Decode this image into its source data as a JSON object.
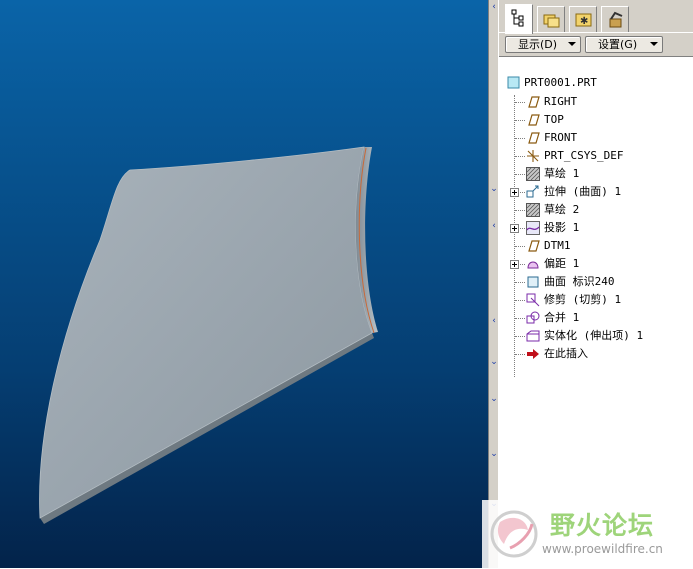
{
  "tabs": [
    {
      "name": "model-tree-tab",
      "icon": "model-tree-icon",
      "active": true
    },
    {
      "name": "folder-browser-tab",
      "icon": "folder-browser-icon",
      "active": false
    },
    {
      "name": "favorites-tab",
      "icon": "favorites-icon",
      "active": false
    },
    {
      "name": "connections-tab",
      "icon": "connections-icon",
      "active": false
    }
  ],
  "toolbar": {
    "show_label": "显示(D)",
    "settings_label": "设置(G)"
  },
  "tree": {
    "root": "PRT0001.PRT",
    "items": [
      {
        "label": "RIGHT",
        "icon": "datum-plane-icon",
        "expandable": false
      },
      {
        "label": "TOP",
        "icon": "datum-plane-icon",
        "expandable": false
      },
      {
        "label": "FRONT",
        "icon": "datum-plane-icon",
        "expandable": false
      },
      {
        "label": "PRT_CSYS_DEF",
        "icon": "coordinate-system-icon",
        "expandable": false
      },
      {
        "label": "草绘 1",
        "icon": "sketch-icon",
        "expandable": false
      },
      {
        "label": "拉伸 (曲面) 1",
        "icon": "extrude-surface-icon",
        "expandable": true
      },
      {
        "label": "草绘 2",
        "icon": "sketch-icon",
        "expandable": false
      },
      {
        "label": "投影 1",
        "icon": "projection-icon",
        "expandable": true
      },
      {
        "label": "DTM1",
        "icon": "datum-plane-icon",
        "expandable": false
      },
      {
        "label": "偏距 1",
        "icon": "offset-icon",
        "expandable": true
      },
      {
        "label": "曲面 标识240",
        "icon": "surface-icon",
        "expandable": false
      },
      {
        "label": "修剪 (切剪) 1",
        "icon": "trim-icon",
        "expandable": false
      },
      {
        "label": "合并 1",
        "icon": "merge-icon",
        "expandable": false
      },
      {
        "label": "实体化 (伸出项) 1",
        "icon": "solidify-icon",
        "expandable": false
      },
      {
        "label": "在此插入",
        "icon": "insert-here-arrow-icon",
        "expandable": false
      }
    ]
  },
  "watermark": {
    "title": "野火论坛",
    "url": "www.proewildfire.cn"
  },
  "colors": {
    "viewport_top": "#0a64a8",
    "viewport_bottom": "#03234a",
    "model_surface": "#9aa5ae",
    "edge_highlight": "#c86a3a",
    "panel_bg": "#d4d0c8",
    "watermark_green": "#9ed47a"
  }
}
